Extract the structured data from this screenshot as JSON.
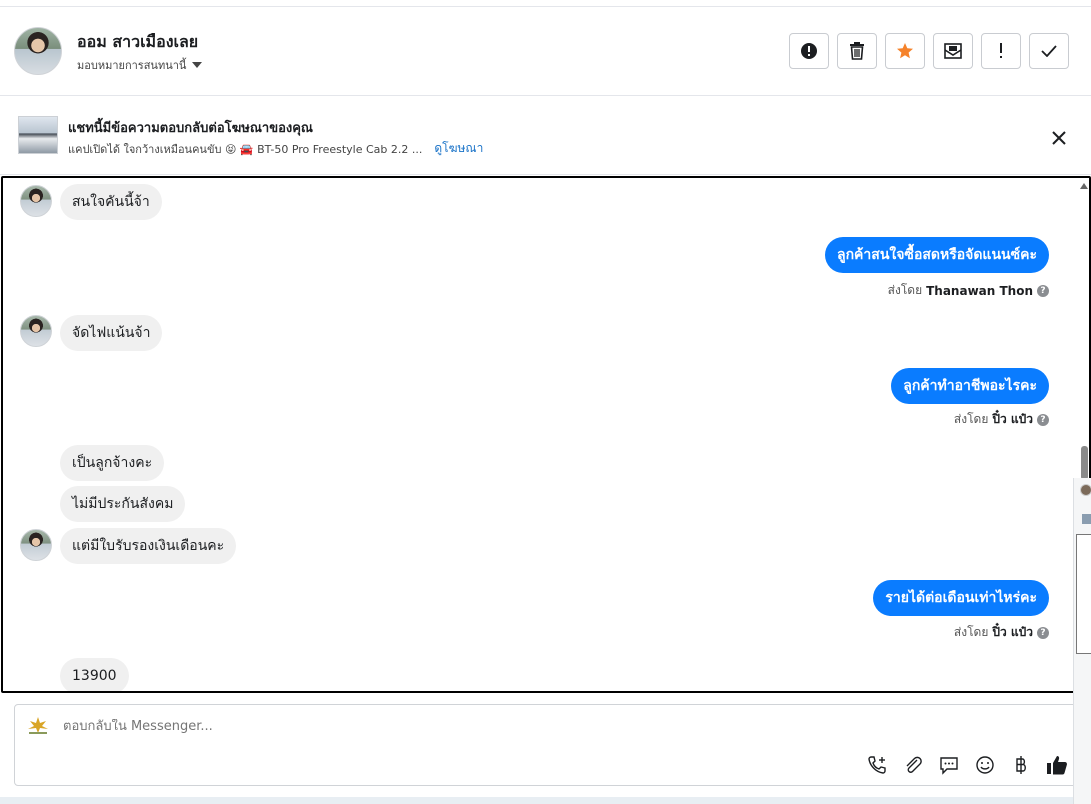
{
  "header": {
    "contact_name": "ออม สาวเมืองเลย",
    "assign_label": "มอบหมายการสนทนานี้",
    "actions": [
      {
        "icon": "alert-circle-icon",
        "name": "mark-spam-button"
      },
      {
        "icon": "trash-icon",
        "name": "delete-button"
      },
      {
        "icon": "star-icon",
        "name": "star-button",
        "color": "#f5822a"
      },
      {
        "icon": "mark-unread-icon",
        "name": "mark-unread-button"
      },
      {
        "icon": "exclamation-icon",
        "name": "follow-up-button"
      },
      {
        "icon": "check-icon",
        "name": "mark-done-button"
      }
    ]
  },
  "ad_banner": {
    "title": "แชทนี้มีข้อความตอบกลับต่อโฆษณาของคุณ",
    "subtitle": "แคปเปิดได้ ใจกว้างเหมือนคนขับ 😝 🚘 BT-50 Pro Freestyle Cab 2.2 ...",
    "link": "ดูโฆษณา"
  },
  "messages": [
    {
      "dir": "in",
      "text": "สนใจคันนี้จ้า",
      "avatar": true
    },
    {
      "dir": "out",
      "text": "ลูกค้าสนใจซื้อสดหรือจัดแนนซ์คะ",
      "sent_by_label": "ส่งโดย",
      "sender": "Thanawan Thon"
    },
    {
      "dir": "in",
      "text": "จัดไฟแน้นจ้า",
      "avatar": true
    },
    {
      "dir": "out",
      "text": "ลูกค้าทำอาชีพอะไรคะ",
      "sent_by_label": "ส่งโดย",
      "sender": "ปิ๋ว แป๋ว"
    },
    {
      "dir": "in",
      "text": "เป็นลูกจ้างคะ",
      "avatar": false
    },
    {
      "dir": "in",
      "text": "ไม่มีประกันสังคม",
      "avatar": false
    },
    {
      "dir": "in",
      "text": "แต่มีใบรับรองเงินเดือนคะ",
      "avatar": true
    },
    {
      "dir": "out",
      "text": "รายได้ต่อเดือนเท่าไหร่คะ",
      "sent_by_label": "ส่งโดย",
      "sender": "ปิ๋ว แป๋ว"
    },
    {
      "dir": "in",
      "text": "13900",
      "avatar": false
    }
  ],
  "composer": {
    "placeholder": "ตอบกลับใน Messenger...",
    "tools": [
      "add-call-icon",
      "attachment-icon",
      "saved-reply-icon",
      "emoji-icon",
      "baht-payment-icon",
      "thumbs-up-icon"
    ]
  },
  "colors": {
    "outgoing_bubble": "#0a7cff",
    "incoming_bubble": "#f0f0f0",
    "link": "#1a73c8",
    "star": "#f5822a"
  }
}
